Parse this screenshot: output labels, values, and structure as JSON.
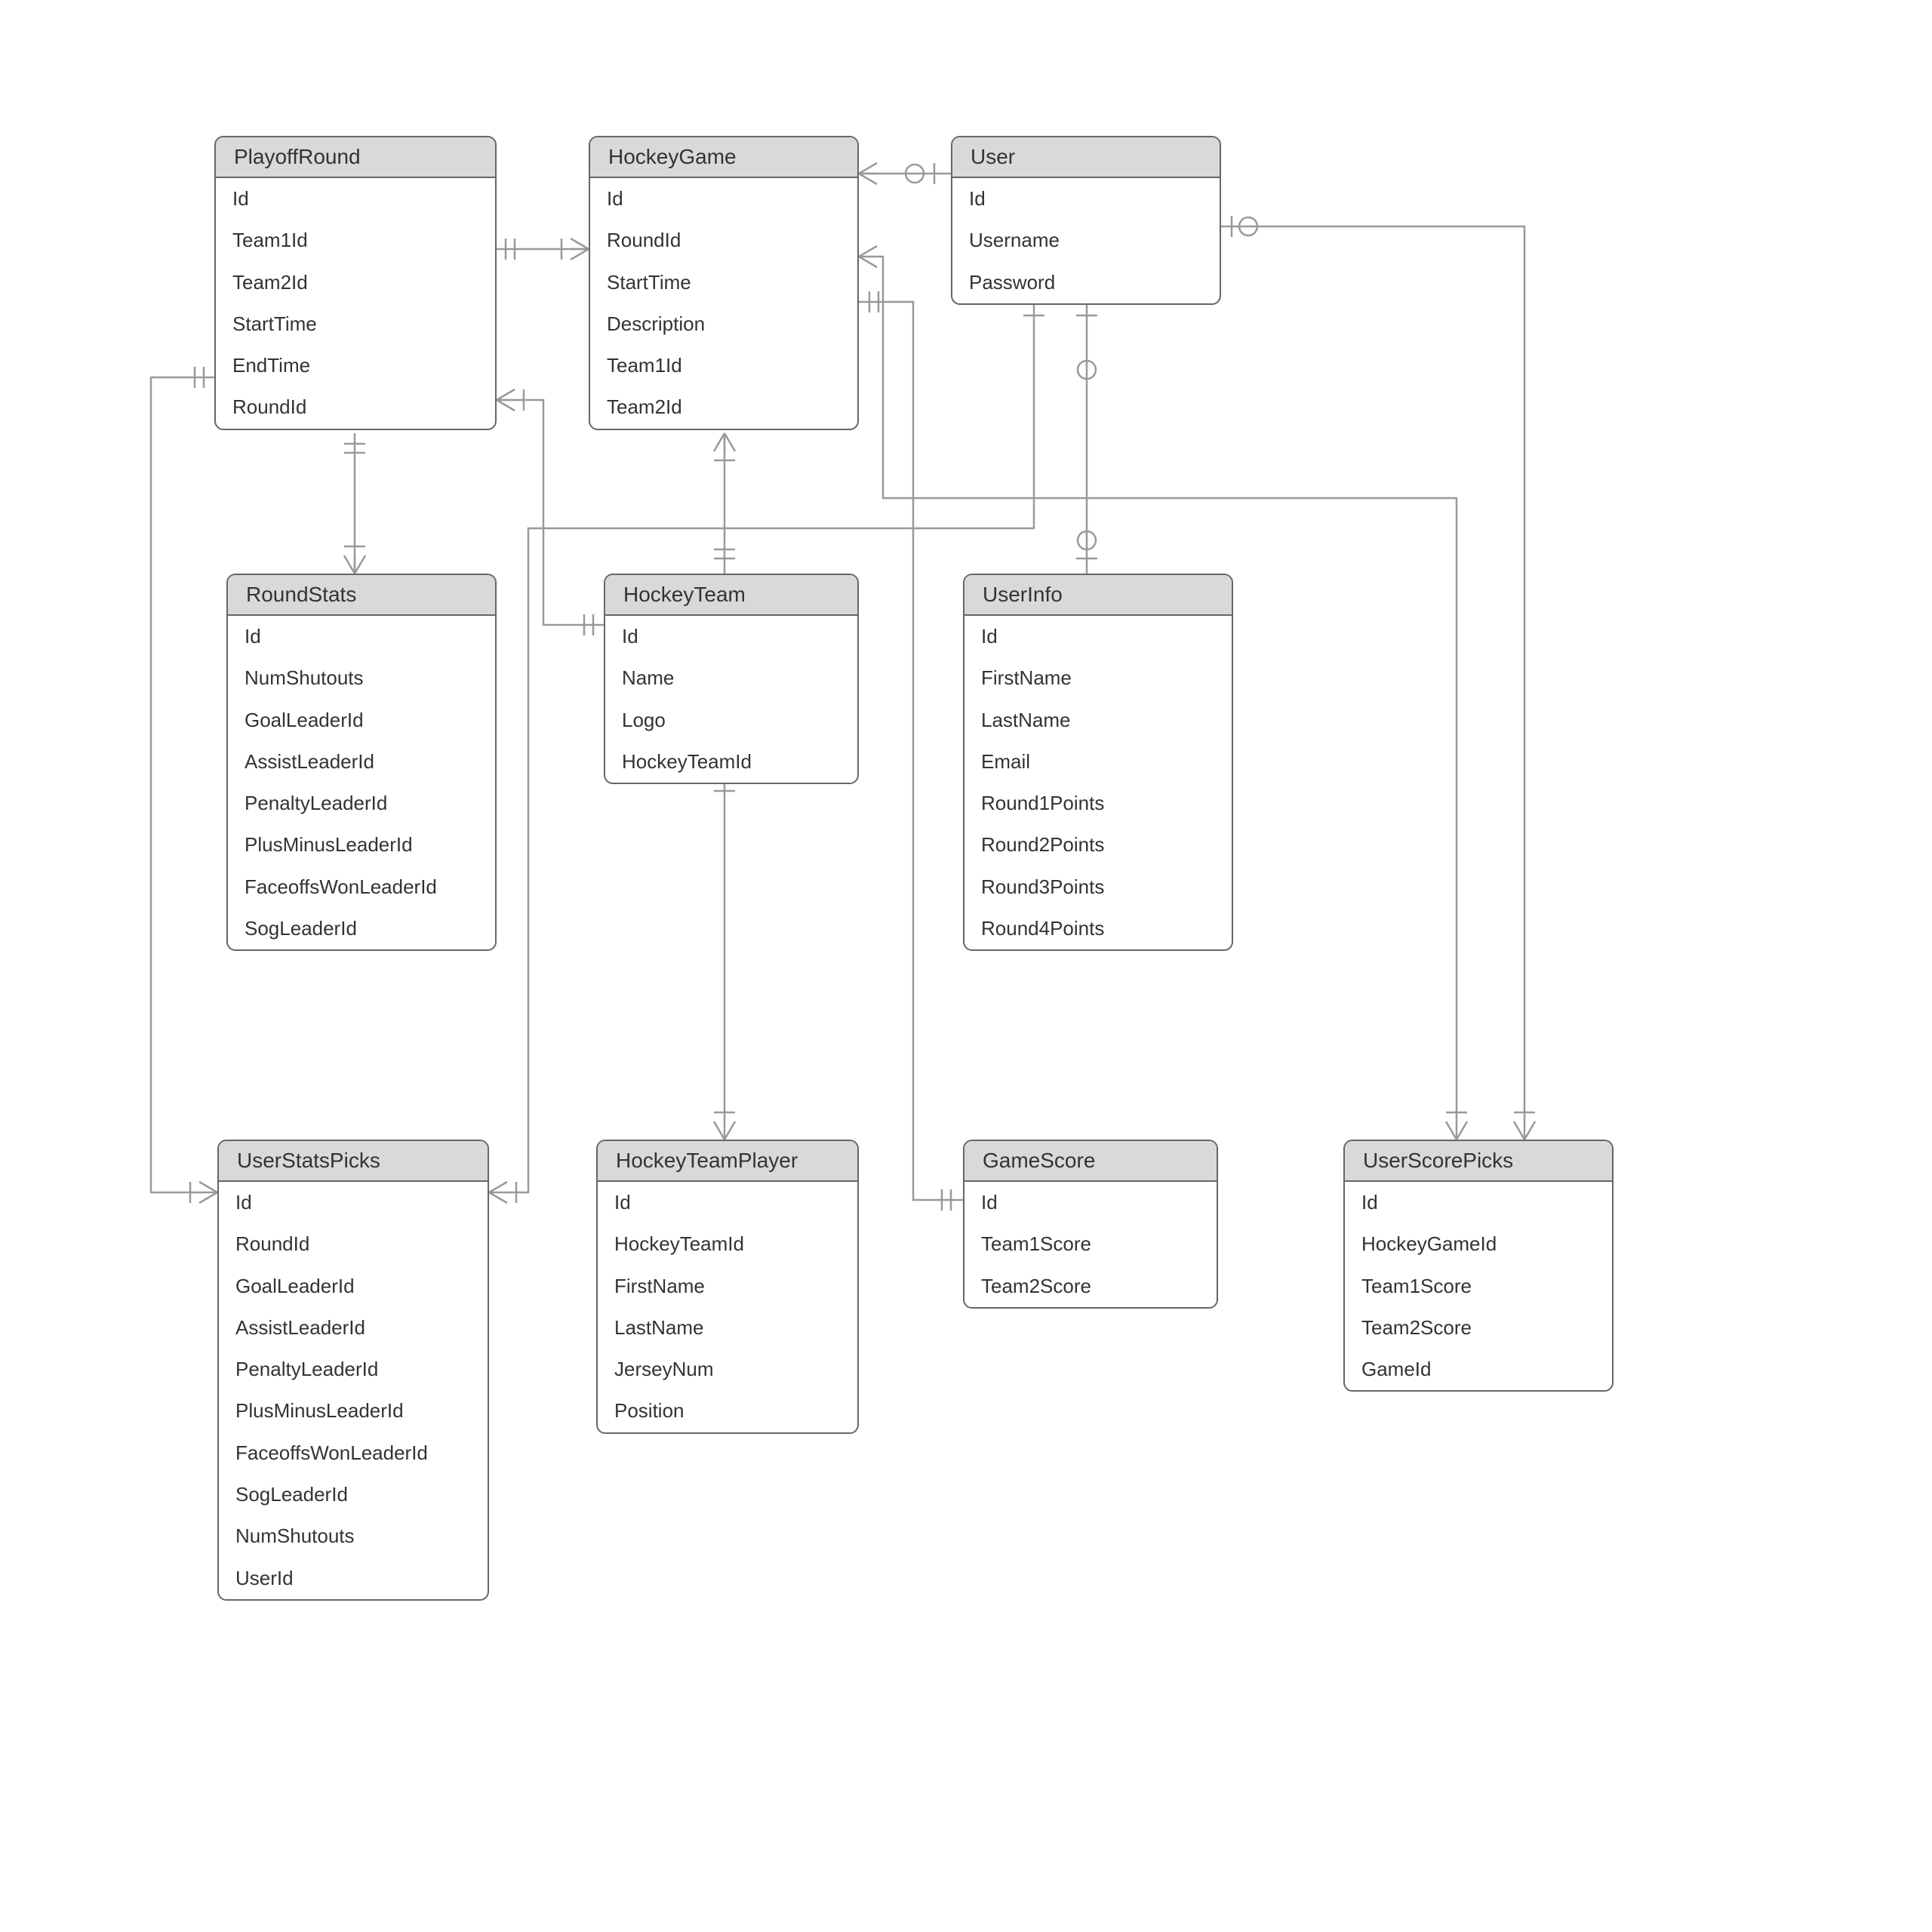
{
  "tables": {
    "playoffRound": {
      "title": "PlayoffRound",
      "fields": [
        "Id",
        "Team1Id",
        "Team2Id",
        "StartTime",
        "EndTime",
        "RoundId"
      ]
    },
    "hockeyGame": {
      "title": "HockeyGame",
      "fields": [
        "Id",
        "RoundId",
        "StartTime",
        "Description",
        "Team1Id",
        "Team2Id"
      ]
    },
    "user": {
      "title": "User",
      "fields": [
        "Id",
        "Username",
        "Password"
      ]
    },
    "roundStats": {
      "title": "RoundStats",
      "fields": [
        "Id",
        "NumShutouts",
        "GoalLeaderId",
        "AssistLeaderId",
        "PenaltyLeaderId",
        "PlusMinusLeaderId",
        "FaceoffsWonLeaderId",
        "SogLeaderId"
      ]
    },
    "hockeyTeam": {
      "title": "HockeyTeam",
      "fields": [
        "Id",
        "Name",
        "Logo",
        "HockeyTeamId"
      ]
    },
    "userInfo": {
      "title": "UserInfo",
      "fields": [
        "Id",
        "FirstName",
        "LastName",
        "Email",
        "Round1Points",
        "Round2Points",
        "Round3Points",
        "Round4Points"
      ]
    },
    "userStatsPicks": {
      "title": "UserStatsPicks",
      "fields": [
        "Id",
        "RoundId",
        "GoalLeaderId",
        "AssistLeaderId",
        "PenaltyLeaderId",
        "PlusMinusLeaderId",
        "FaceoffsWonLeaderId",
        "SogLeaderId",
        "NumShutouts",
        "UserId"
      ]
    },
    "hockeyTeamPlayer": {
      "title": "HockeyTeamPlayer",
      "fields": [
        "Id",
        "HockeyTeamId",
        "FirstName",
        "LastName",
        "JerseyNum",
        "Position"
      ]
    },
    "gameScore": {
      "title": "GameScore",
      "fields": [
        "Id",
        "Team1Score",
        "Team2Score"
      ]
    },
    "userScorePicks": {
      "title": "UserScorePicks",
      "fields": [
        "Id",
        "HockeyGameId",
        "Team1Score",
        "Team2Score",
        "GameId"
      ]
    }
  },
  "relations": [
    {
      "from": "playoffRound",
      "to": "hockeyGame",
      "type": "one-to-many"
    },
    {
      "from": "playoffRound",
      "to": "roundStats",
      "type": "one-to-many"
    },
    {
      "from": "playoffRound",
      "to": "hockeyTeam",
      "type": "many-to-one"
    },
    {
      "from": "playoffRound",
      "to": "userStatsPicks",
      "type": "one-to-many"
    },
    {
      "from": "hockeyGame",
      "to": "hockeyTeam",
      "type": "many-to-one"
    },
    {
      "from": "hockeyGame",
      "to": "user",
      "type": "many-to-zero-or-one"
    },
    {
      "from": "hockeyGame",
      "to": "gameScore",
      "type": "one-to-one"
    },
    {
      "from": "hockeyGame",
      "to": "userScorePicks",
      "type": "one-to-many"
    },
    {
      "from": "hockeyTeam",
      "to": "hockeyTeamPlayer",
      "type": "one-to-many"
    },
    {
      "from": "user",
      "to": "userInfo",
      "type": "one-to-zero-or-one"
    },
    {
      "from": "user",
      "to": "userStatsPicks",
      "type": "one-to-many"
    },
    {
      "from": "user",
      "to": "userScorePicks",
      "type": "one-to-many"
    }
  ]
}
